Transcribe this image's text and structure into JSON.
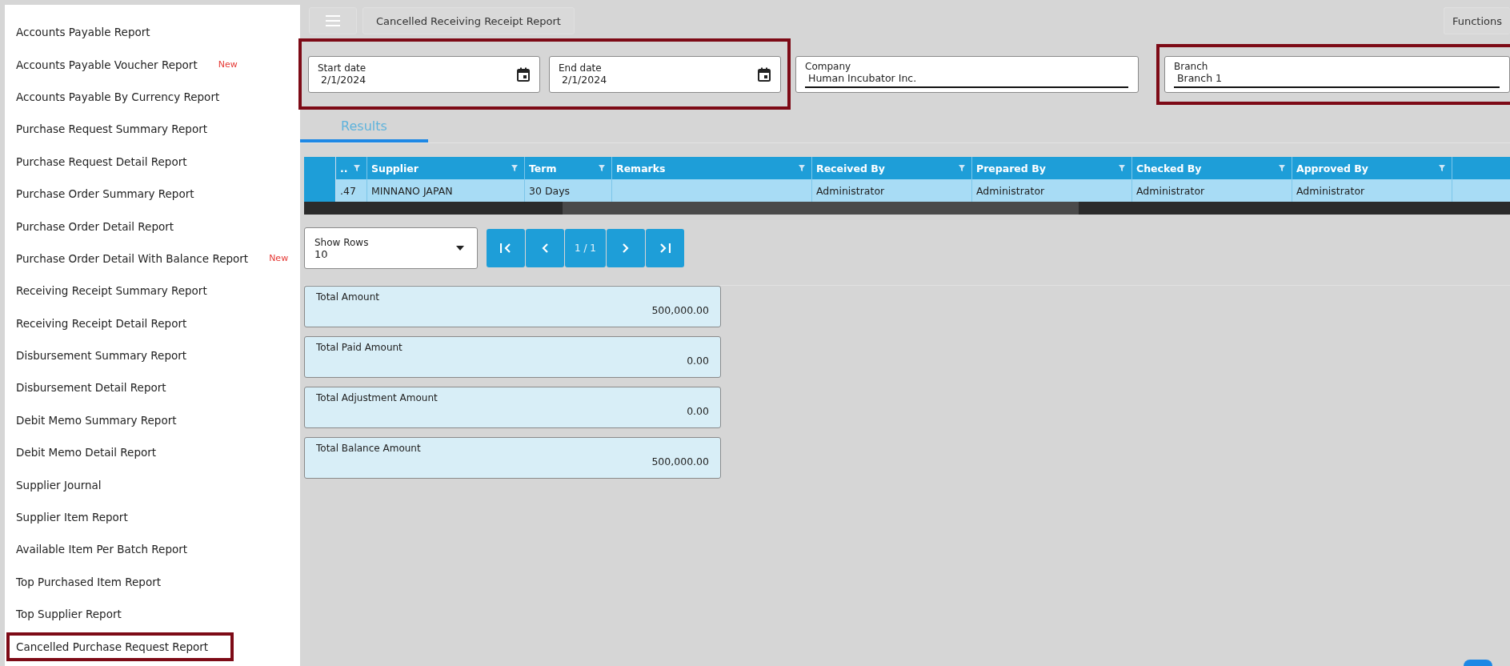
{
  "sidebar": {
    "items": [
      {
        "label": "Accounts Payable Report",
        "highlighted": false
      },
      {
        "label": "Accounts Payable Voucher Report",
        "badge": "New",
        "highlighted": false
      },
      {
        "label": "Accounts Payable By Currency Report",
        "highlighted": false
      },
      {
        "label": "Purchase Request Summary Report",
        "highlighted": false
      },
      {
        "label": "Purchase Request Detail Report",
        "highlighted": false
      },
      {
        "label": "Purchase Order Summary Report",
        "highlighted": false
      },
      {
        "label": "Purchase Order Detail Report",
        "highlighted": false
      },
      {
        "label": "Purchase Order Detail With Balance Report",
        "badge": "New",
        "highlighted": false
      },
      {
        "label": "Receiving Receipt Summary Report",
        "highlighted": false
      },
      {
        "label": "Receiving Receipt Detail Report",
        "highlighted": false
      },
      {
        "label": "Disbursement Summary Report",
        "highlighted": false
      },
      {
        "label": "Disbursement Detail Report",
        "highlighted": false
      },
      {
        "label": "Debit Memo Summary Report",
        "highlighted": false
      },
      {
        "label": "Debit Memo Detail Report",
        "highlighted": false
      },
      {
        "label": "Supplier Journal",
        "highlighted": false
      },
      {
        "label": "Supplier Item Report",
        "highlighted": false
      },
      {
        "label": "Available Item Per Batch Report",
        "highlighted": false
      },
      {
        "label": "Top Purchased Item Report",
        "highlighted": false
      },
      {
        "label": "Top Supplier Report",
        "highlighted": false
      },
      {
        "label": "Cancelled Purchase Request Report",
        "highlighted": true
      }
    ]
  },
  "toolbar": {
    "title": "Cancelled Receiving Receipt Report",
    "functions": "Functions"
  },
  "filter_groups": [
    {
      "highlighted": true,
      "fields": [
        {
          "kind": "date",
          "label": "Start date",
          "value": "2/1/2024"
        },
        {
          "kind": "date",
          "label": "End date",
          "value": "2/1/2024"
        }
      ]
    },
    {
      "highlighted": false,
      "fields": [
        {
          "kind": "select",
          "label": "Company",
          "value": "Human Incubator Inc."
        }
      ]
    },
    {
      "highlighted": true,
      "fields": [
        {
          "kind": "select",
          "label": "Branch",
          "value": "Branch 1"
        }
      ]
    }
  ],
  "tabs": [
    {
      "label": "Results",
      "selected": true
    }
  ],
  "table": {
    "columns": [
      "..",
      "Supplier",
      "Term",
      "Remarks",
      "Received By",
      "Prepared By",
      "Checked By",
      "Approved By"
    ],
    "rows": [
      {
        "cells": [
          ".47",
          "MINNANO JAPAN",
          "30 Days",
          "",
          "Administrator",
          "Administrator",
          "Administrator",
          "Administrator"
        ]
      }
    ]
  },
  "show_rows": {
    "label": "Show Rows",
    "value": "10"
  },
  "pager": [
    {
      "kind": "first"
    },
    {
      "kind": "prev"
    },
    {
      "kind": "page",
      "label": "1 / 1"
    },
    {
      "kind": "next"
    },
    {
      "kind": "last"
    }
  ],
  "totals": [
    {
      "label": "Total Amount",
      "value": "500,000.00"
    },
    {
      "label": "Total Paid Amount",
      "value": "0.00"
    },
    {
      "label": "Total Adjustment Amount",
      "value": "0.00"
    },
    {
      "label": "Total Balance Amount",
      "value": "500,000.00"
    }
  ]
}
